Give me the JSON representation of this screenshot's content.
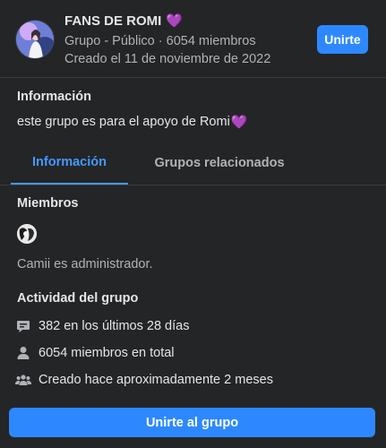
{
  "group": {
    "name": "FANS DE ROMI",
    "name_emoji": "💜",
    "meta": "Grupo - Público · 6054 miembros",
    "created": "Creado el 11 de noviembre de 2022",
    "join_label": "Unirte"
  },
  "info": {
    "title": "Información",
    "description": "este grupo es para el apoyo de Romi",
    "description_emoji": "💜"
  },
  "tabs": [
    {
      "label": "Información",
      "active": true
    },
    {
      "label": "Grupos relacionados",
      "active": false
    }
  ],
  "members": {
    "title": "Miembros",
    "admin_text": "Camii es administrador."
  },
  "activity": {
    "title": "Actividad del grupo",
    "rows": [
      {
        "icon": "chat-bubble-icon",
        "text": "382 en los últimos 28 días"
      },
      {
        "icon": "person-icon",
        "text": "6054 miembros en total"
      },
      {
        "icon": "people-group-icon",
        "text": "Creado hace aproximadamente 2 meses"
      }
    ]
  },
  "footer": {
    "join_group_label": "Unirte al grupo"
  },
  "colors": {
    "background": "#242526",
    "accent": "#2d88ff",
    "active_tab": "#4599ff",
    "heart": "#a855f7"
  }
}
